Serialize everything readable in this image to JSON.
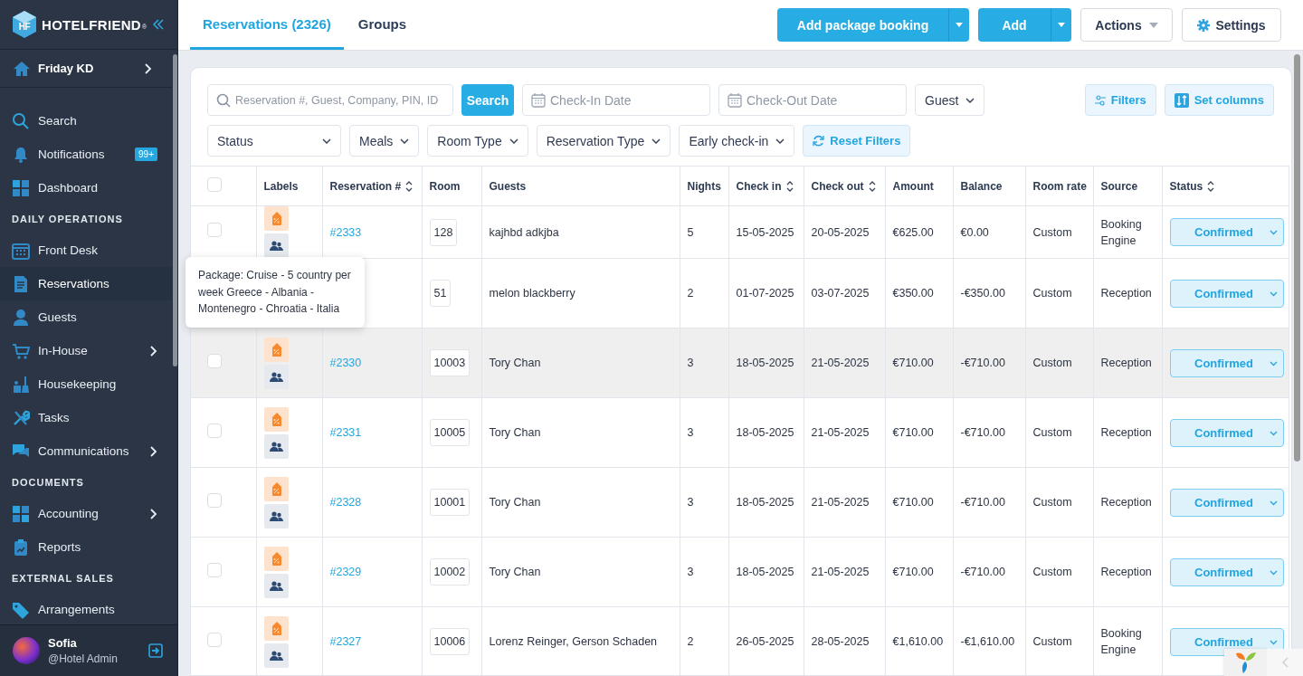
{
  "sidebar": {
    "brand": "HOTELFRIEND",
    "brand_mark": "®",
    "logo_letters": "HF",
    "property": "Friday KD",
    "items": [
      {
        "kind": "item",
        "label": "Search",
        "selected": false,
        "submenu": false
      },
      {
        "kind": "item",
        "label": "Notifications",
        "badge": "99+",
        "selected": false,
        "submenu": false
      },
      {
        "kind": "item",
        "label": "Dashboard",
        "selected": false,
        "submenu": false
      },
      {
        "kind": "heading",
        "label": "DAILY OPERATIONS"
      },
      {
        "kind": "item",
        "label": "Front Desk",
        "selected": false,
        "submenu": false
      },
      {
        "kind": "item",
        "label": "Reservations",
        "selected": true,
        "submenu": false
      },
      {
        "kind": "item",
        "label": "Guests",
        "selected": false,
        "submenu": false
      },
      {
        "kind": "item",
        "label": "In-House",
        "selected": false,
        "submenu": true
      },
      {
        "kind": "item",
        "label": "Housekeeping",
        "selected": false,
        "submenu": false
      },
      {
        "kind": "item",
        "label": "Tasks",
        "selected": false,
        "submenu": false
      },
      {
        "kind": "item",
        "label": "Communications",
        "selected": false,
        "submenu": true
      },
      {
        "kind": "heading",
        "label": "DOCUMENTS"
      },
      {
        "kind": "item",
        "label": "Accounting",
        "selected": false,
        "submenu": true
      },
      {
        "kind": "item",
        "label": "Reports",
        "selected": false,
        "submenu": false
      },
      {
        "kind": "heading",
        "label": "EXTERNAL SALES"
      },
      {
        "kind": "item",
        "label": "Arrangements",
        "selected": false,
        "submenu": false
      }
    ],
    "user": {
      "name": "Sofia",
      "role": "@Hotel Admin"
    }
  },
  "tabs": [
    {
      "label": "Reservations (2326)",
      "selected": true
    },
    {
      "label": "Groups",
      "selected": false
    }
  ],
  "toolbar": [
    {
      "kind": "split",
      "label": "Add package booking"
    },
    {
      "kind": "split",
      "label": "Add"
    },
    {
      "kind": "dropdown",
      "label": "Actions"
    },
    {
      "kind": "settings",
      "label": "Settings"
    }
  ],
  "filters": {
    "search": {
      "placeholder": "Reservation #, Guest, Company, PIN, ID"
    },
    "search_button": "Search",
    "dates": [
      {
        "placeholder": "Check-In Date"
      },
      {
        "placeholder": "Check-Out Date"
      }
    ],
    "guest": "Guest",
    "filters_button": "Filters",
    "columns_button": "Set columns",
    "dropdowns": [
      "Status",
      "Meals",
      "Room Type",
      "Reservation Type",
      "Early check-in"
    ],
    "reset": "Reset Filters"
  },
  "table": {
    "all_checked": false,
    "columns": [
      {
        "label": "Labels",
        "sortable": false
      },
      {
        "label": "Reservation #",
        "sortable": true
      },
      {
        "label": "Room",
        "sortable": false
      },
      {
        "label": "Guests",
        "sortable": false
      },
      {
        "label": "Nights",
        "sortable": false
      },
      {
        "label": "Check in",
        "sortable": true
      },
      {
        "label": "Check out",
        "sortable": true
      },
      {
        "label": "Amount",
        "sortable": false
      },
      {
        "label": "Balance",
        "sortable": false
      },
      {
        "label": "Room rate",
        "sortable": false
      },
      {
        "label": "Source",
        "sortable": false
      },
      {
        "label": "Status",
        "sortable": true
      }
    ],
    "rows": [
      {
        "checked": false,
        "highlighted": false,
        "labels": [
          {
            "kind": "package"
          },
          {
            "kind": "group"
          }
        ],
        "number": "#2333",
        "room": "128",
        "guests": "kajhbd adkjba",
        "nights": "5",
        "check_in": "15-05-2025",
        "check_out": "20-05-2025",
        "amount": "€625.00",
        "balance": "€0.00",
        "rate": "Custom",
        "source": "Booking Engine",
        "status": "Confirmed"
      },
      {
        "highlighted": false,
        "labels": [],
        "room": "51",
        "guests": "melon blackberry",
        "nights": "2",
        "check_in": "01-07-2025",
        "check_out": "03-07-2025",
        "amount": "€350.00",
        "balance": "-€350.00",
        "rate": "Custom",
        "source": "Reception",
        "status": "Confirmed"
      },
      {
        "checked": false,
        "highlighted": true,
        "labels": [
          {
            "kind": "package"
          },
          {
            "kind": "group"
          }
        ],
        "number": "#2330",
        "room": "10003",
        "guests": "Tory Chan",
        "nights": "3",
        "check_in": "18-05-2025",
        "check_out": "21-05-2025",
        "amount": "€710.00",
        "balance": "-€710.00",
        "rate": "Custom",
        "source": "Reception",
        "status": "Confirmed"
      },
      {
        "checked": false,
        "highlighted": false,
        "labels": [
          {
            "kind": "package"
          },
          {
            "kind": "group"
          }
        ],
        "number": "#2331",
        "room": "10005",
        "guests": "Tory Chan",
        "nights": "3",
        "check_in": "18-05-2025",
        "check_out": "21-05-2025",
        "amount": "€710.00",
        "balance": "-€710.00",
        "rate": "Custom",
        "source": "Reception",
        "status": "Confirmed"
      },
      {
        "checked": false,
        "highlighted": false,
        "labels": [
          {
            "kind": "package"
          },
          {
            "kind": "group"
          }
        ],
        "number": "#2328",
        "room": "10001",
        "guests": "Tory Chan",
        "nights": "3",
        "check_in": "18-05-2025",
        "check_out": "21-05-2025",
        "amount": "€710.00",
        "balance": "-€710.00",
        "rate": "Custom",
        "source": "Reception",
        "status": "Confirmed"
      },
      {
        "checked": false,
        "highlighted": false,
        "labels": [
          {
            "kind": "package"
          },
          {
            "kind": "group"
          }
        ],
        "number": "#2329",
        "room": "10002",
        "guests": "Tory Chan",
        "nights": "3",
        "check_in": "18-05-2025",
        "check_out": "21-05-2025",
        "amount": "€710.00",
        "balance": "-€710.00",
        "rate": "Custom",
        "source": "Reception",
        "status": "Confirmed"
      },
      {
        "checked": false,
        "highlighted": false,
        "labels": [
          {
            "kind": "package"
          },
          {
            "kind": "group"
          }
        ],
        "number": "#2327",
        "room": "10006",
        "guests": "Lorenz Reinger, Gerson Schaden",
        "nights": "2",
        "check_in": "26-05-2025",
        "check_out": "28-05-2025",
        "amount": "€1,610.00",
        "balance": "-€1,610.00",
        "rate": "Custom",
        "source": "Booking Engine",
        "status": "Confirmed"
      }
    ]
  },
  "tooltip": {
    "text": "Package: Cruise - 5 country per week Greece - Albania - Montenegro - Chroatia - Italia"
  }
}
